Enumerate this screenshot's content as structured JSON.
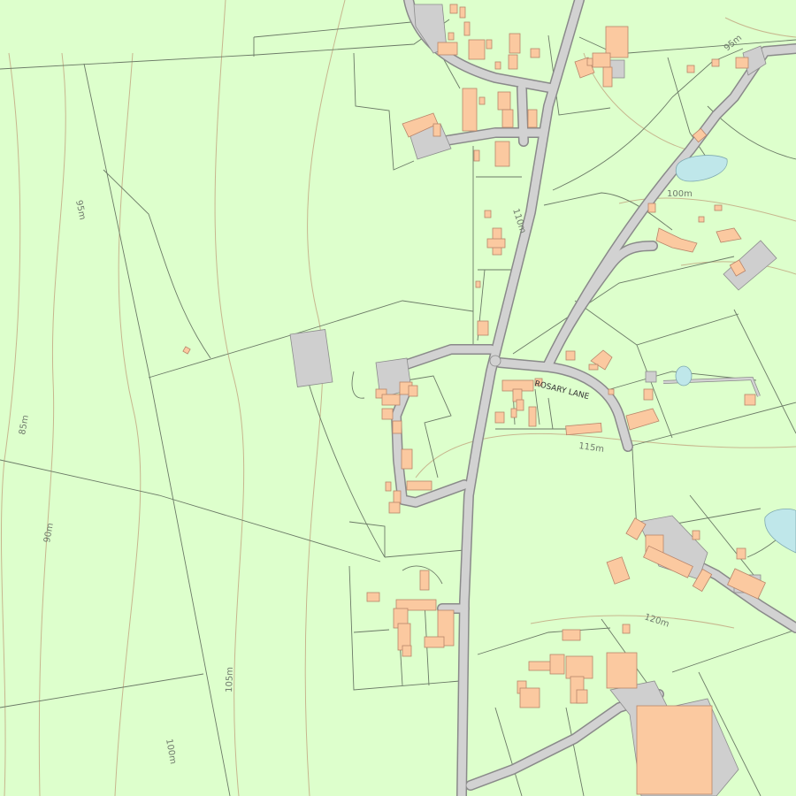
{
  "colors": {
    "land": "#ddffcc",
    "contour": "#c7b68e",
    "field_boundary": "#6b7a66",
    "road": "#d2d2d2",
    "building": "#fbc9a0",
    "yard": "#cfcfcf",
    "water": "#bfe7ea"
  },
  "road_name": "ROSARY LANE",
  "contour_labels": [
    {
      "id": "95-top",
      "text": "95m"
    },
    {
      "id": "95-left",
      "text": "95m"
    },
    {
      "id": "100-upper",
      "text": "100m"
    },
    {
      "id": "110",
      "text": "110m"
    },
    {
      "id": "85",
      "text": "85m"
    },
    {
      "id": "115",
      "text": "115m"
    },
    {
      "id": "90",
      "text": "90m"
    },
    {
      "id": "120",
      "text": "120m"
    },
    {
      "id": "105",
      "text": "105m"
    },
    {
      "id": "100-lower",
      "text": "100m"
    }
  ]
}
